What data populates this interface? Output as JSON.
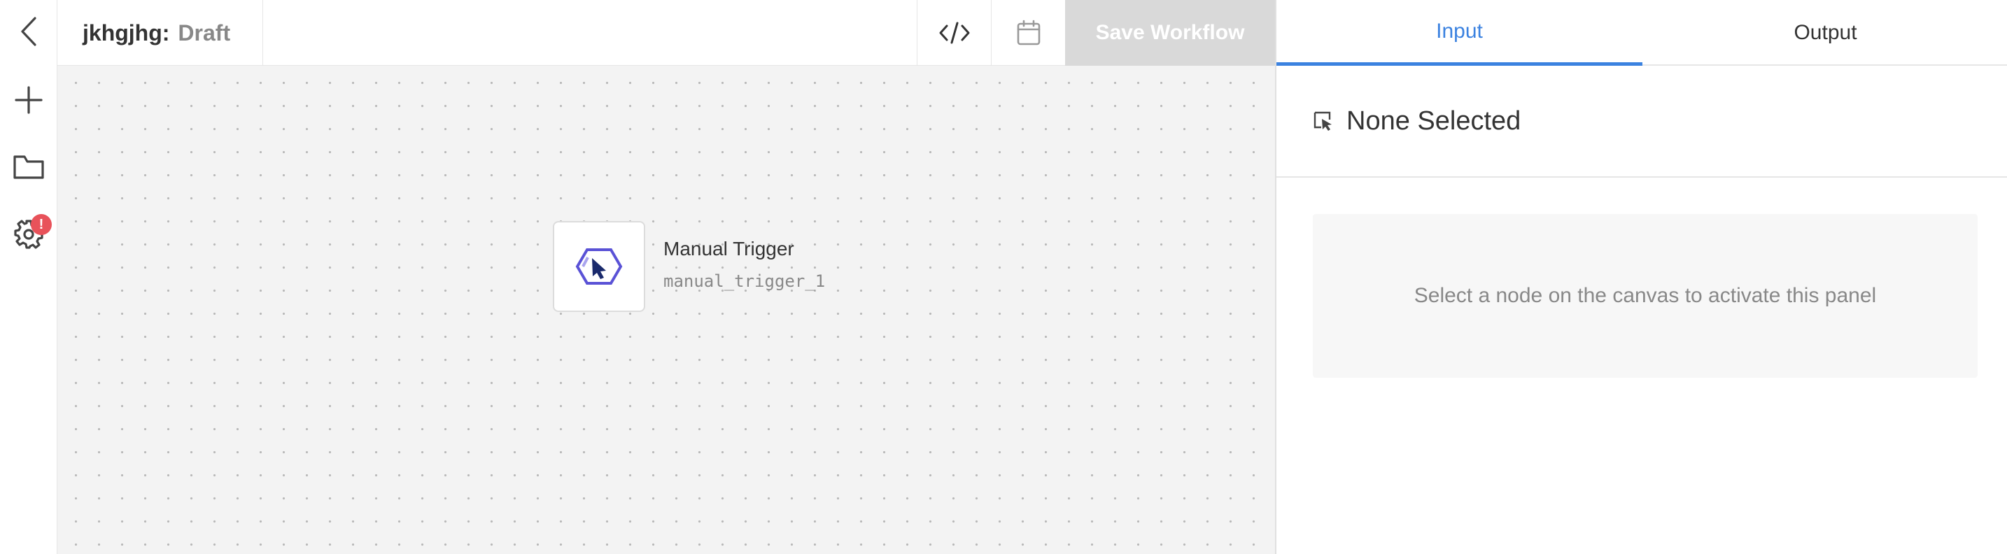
{
  "workflow": {
    "name": "jkhgjhg:",
    "status": "Draft"
  },
  "toolbar": {
    "save_label": "Save Workflow"
  },
  "sidebar": {
    "settings_badge": "!"
  },
  "canvas": {
    "nodes": [
      {
        "title": "Manual Trigger",
        "id": "manual_trigger_1"
      }
    ]
  },
  "panel": {
    "tabs": [
      {
        "label": "Input",
        "active": true
      },
      {
        "label": "Output",
        "active": false
      }
    ],
    "selection_title": "None Selected",
    "empty_message": "Select a node on the canvas to activate this panel"
  },
  "colors": {
    "accent": "#3b82e0",
    "badge": "#e8525a",
    "node_icon": "#5a52d6",
    "node_cursor": "#1a2a6c"
  }
}
